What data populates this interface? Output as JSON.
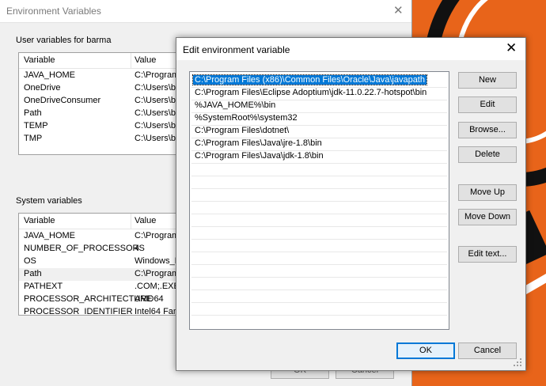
{
  "background_window": {
    "title": "Environment Variables",
    "close_glyph": "✕",
    "user_section_label": "User variables for barma",
    "system_section_label": "System variables",
    "columns": [
      "Variable",
      "Value"
    ],
    "user_vars": [
      {
        "name": "JAVA_HOME",
        "value": "C:\\Program"
      },
      {
        "name": "OneDrive",
        "value": "C:\\Users\\ba"
      },
      {
        "name": "OneDriveConsumer",
        "value": "C:\\Users\\ba"
      },
      {
        "name": "Path",
        "value": "C:\\Users\\ba"
      },
      {
        "name": "TEMP",
        "value": "C:\\Users\\ba"
      },
      {
        "name": "TMP",
        "value": "C:\\Users\\ba"
      }
    ],
    "system_vars": [
      {
        "name": "JAVA_HOME",
        "value": "C:\\Program"
      },
      {
        "name": "NUMBER_OF_PROCESSORS",
        "value": "4"
      },
      {
        "name": "OS",
        "value": "Windows_N"
      },
      {
        "name": "Path",
        "value": "C:\\Program"
      },
      {
        "name": "PATHEXT",
        "value": ".COM;.EXE;."
      },
      {
        "name": "PROCESSOR_ARCHITECTURE",
        "value": "AMD64"
      },
      {
        "name": "PROCESSOR_IDENTIFIER",
        "value": "Intel64 Fam"
      }
    ],
    "ok_label": "OK",
    "cancel_label": "Cancel"
  },
  "dialog": {
    "title": "Edit environment variable",
    "close_glyph": "✕",
    "paths": [
      "C:\\Program Files (x86)\\Common Files\\Oracle\\Java\\javapath",
      "C:\\Program Files\\Eclipse Adoptium\\jdk-11.0.22.7-hotspot\\bin",
      "%JAVA_HOME%\\bin",
      "%SystemRoot%\\system32",
      "C:\\Program Files\\dotnet\\",
      "C:\\Program Files\\Java\\jre-1.8\\bin",
      "C:\\Program Files\\Java\\jdk-1.8\\bin"
    ],
    "selected_index": 0,
    "buttons": {
      "new": "New",
      "edit": "Edit",
      "browse": "Browse...",
      "delete": "Delete",
      "move_up": "Move Up",
      "move_down": "Move Down",
      "edit_text": "Edit text...",
      "ok": "OK",
      "cancel": "Cancel"
    }
  },
  "colors": {
    "selection": "#0078d7",
    "window_bg": "#f0f0f0",
    "wallpaper": "#e8641a"
  }
}
